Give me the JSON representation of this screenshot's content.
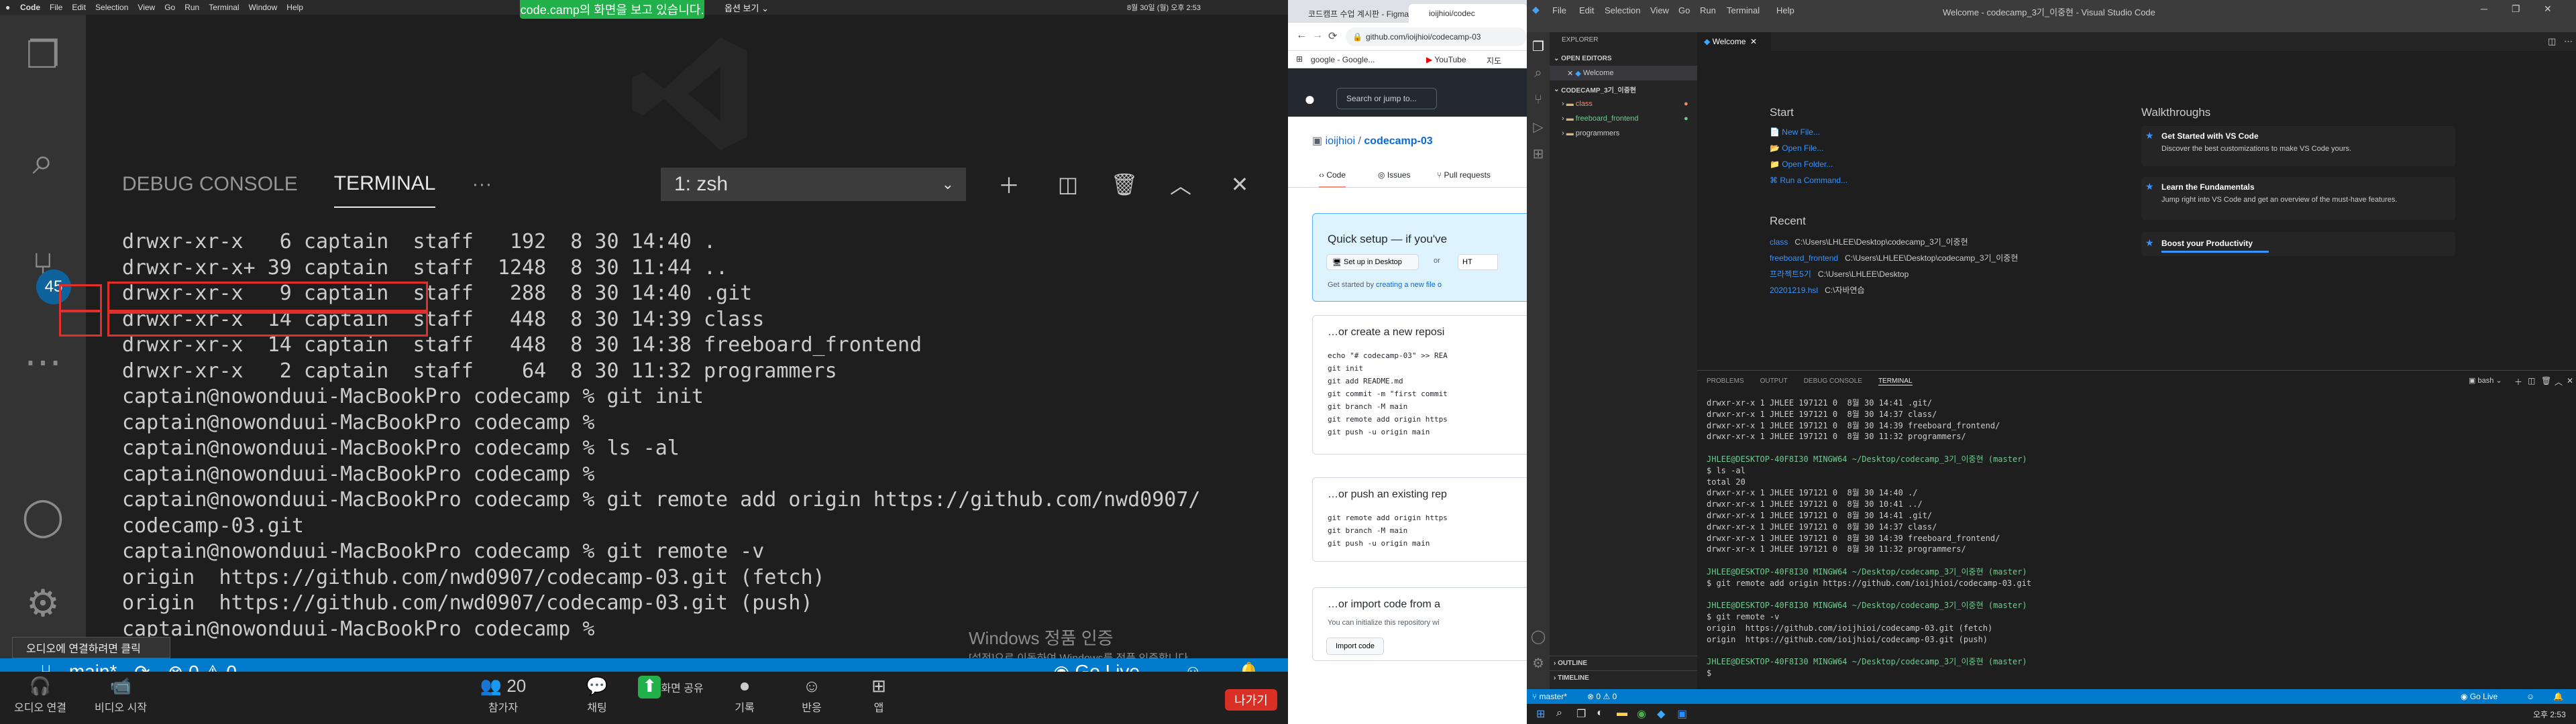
{
  "zoom_share": {
    "mac_menu": [
      "Code",
      "File",
      "Edit",
      "Selection",
      "View",
      "Go",
      "Run",
      "Terminal",
      "Window",
      "Help"
    ],
    "sharing_banner": "code.camp의 화면을 보고 있습니다.",
    "view_options": "옵션 보기 ⌄",
    "top_right_text": "8월 30일 (월) 오후 2:53",
    "activity_badge": "45",
    "panel_tabs": [
      "DEBUG CONSOLE",
      "TERMINAL",
      "···"
    ],
    "terminal_select": "1: zsh",
    "terminal_lines": [
      "drwxr-xr-x   6 captain  staff   192  8 30 14:40 .",
      "drwxr-xr-x+ 39 captain  staff  1248  8 30 11:44 ..",
      "drwxr-xr-x   9 captain  staff   288  8 30 14:40 .git",
      "drwxr-xr-x  14 captain  staff   448  8 30 14:39 class",
      "drwxr-xr-x  14 captain  staff   448  8 30 14:38 freeboard_frontend",
      "drwxr-xr-x   2 captain  staff    64  8 30 11:32 programmers",
      "captain@nowonduui-MacBookPro codecamp % git init",
      "captain@nowonduui-MacBookPro codecamp %",
      "captain@nowonduui-MacBookPro codecamp % ls -al",
      "captain@nowonduui-MacBookPro codecamp %",
      "captain@nowonduui-MacBookPro codecamp % git remote add origin https://github.com/nwd0907/",
      "codecamp-03.git",
      "captain@nowonduui-MacBookPro codecamp % git remote -v",
      "origin  https://github.com/nwd0907/codecamp-03.git (fetch)",
      "origin  https://github.com/nwd0907/codecamp-03.git (push)",
      "captain@nowonduui-MacBookPro codecamp % "
    ],
    "status_branch": "main*",
    "status_problems": "⊗ 0 ⚠ 0",
    "go_live": "Go Live",
    "windows_watermark": "Windows 정품 인증",
    "windows_watermark_sub": "[설정]으로 이동하여 Windows를 정품 인증합니다.",
    "tooltip": "오디오에 연결하려면 클릭",
    "controls": [
      {
        "label": "오디오 연결",
        "icon": "🎧"
      },
      {
        "label": "비디오 시작",
        "icon": "📹"
      },
      {
        "label": "참가자",
        "icon": "👥",
        "count": "20"
      },
      {
        "label": "채팅",
        "icon": "💬"
      },
      {
        "label": "화면 공유",
        "icon": "⬆"
      },
      {
        "label": "기록",
        "icon": "⏺"
      },
      {
        "label": "반응",
        "icon": "☺"
      },
      {
        "label": "앱",
        "icon": "⊞"
      }
    ],
    "leave_button": "나가기"
  },
  "browser": {
    "tabs": [
      "코드캠프 수업 계시판 - Figma",
      "ioijhioi/codec"
    ],
    "url": "github.com/ioijhioi/codecamp-03",
    "bookmarks": [
      "google - Google...",
      "YouTube",
      "지도"
    ],
    "search_placeholder": "Search or jump to...",
    "repo_owner": "ioijhioi",
    "repo_name": "codecamp-03",
    "repo_tabs": [
      "Code",
      "Issues",
      "Pull requests"
    ],
    "quick_setup": "Quick setup — if you've",
    "setup_desktop": "Set up in Desktop",
    "or": "or",
    "https_label": "HT",
    "get_started_prefix": "Get started by",
    "get_started_link": "creating a new file o",
    "section_create": "…or create a new reposi",
    "create_cmds": [
      "echo \"# codecamp-03\" >> REA",
      "git init",
      "git add README.md",
      "git commit -m \"first commit",
      "git branch -M main",
      "git remote add origin https",
      "git push -u origin main"
    ],
    "section_push": "…or push an existing rep",
    "push_cmds": [
      "git remote add origin https",
      "git branch -M main",
      "git push -u origin main"
    ],
    "section_import": "…or import code from a",
    "import_desc": "You can initialize this repository wi",
    "import_button": "Import code"
  },
  "vscode": {
    "menu": [
      "File",
      "Edit",
      "Selection",
      "View",
      "Go",
      "Run",
      "Terminal",
      "Help"
    ],
    "title": "Welcome - codecamp_3기_이중현 - Visual Studio Code",
    "explorer_title": "EXPLORER",
    "open_editors": "OPEN EDITORS",
    "open_editor_item": "Welcome",
    "workspace": "CODECAMP_3기_이중현",
    "folders": [
      {
        "name": "class",
        "color": "#f48771"
      },
      {
        "name": "freeboard_frontend",
        "color": "#73c991"
      },
      {
        "name": "programmers",
        "color": "#cccccc"
      }
    ],
    "outline": "OUTLINE",
    "timeline": "TIMELINE",
    "editor_tab": "Welcome",
    "start_title": "Start",
    "start_links": [
      "New File...",
      "Open File...",
      "Open Folder...",
      "Run a Command..."
    ],
    "recent_title": "Recent",
    "recent": [
      {
        "name": "class",
        "path": "C:\\Users\\LHLEE\\Desktop\\codecamp_3기_이중현"
      },
      {
        "name": "freeboard_frontend",
        "path": "C:\\Users\\LHLEE\\Desktop\\codecamp_3기_이중현"
      },
      {
        "name": "프라젝트5기",
        "path": "C:\\Users\\LHLEE\\Desktop"
      },
      {
        "name": "20201219.hsl",
        "path": "C:\\자바연습"
      }
    ],
    "walkthroughs_title": "Walkthroughs",
    "walkthroughs": [
      {
        "title": "Get Started with VS Code",
        "desc": "Discover the best customizations to make VS Code yours."
      },
      {
        "title": "Learn the Fundamentals",
        "desc": "Jump right into VS Code and get an overview of the must-have features."
      },
      {
        "title": "Boost your Productivity",
        "desc": ""
      }
    ],
    "panel_tabs": [
      "PROBLEMS",
      "OUTPUT",
      "DEBUG CONSOLE",
      "TERMINAL"
    ],
    "terminal_select": "bash",
    "terminal_lines": [
      "drwxr-xr-x 1 JHLEE 197121 0  8월 30 14:41 .git/",
      "drwxr-xr-x 1 JHLEE 197121 0  8월 30 14:37 class/",
      "drwxr-xr-x 1 JHLEE 197121 0  8월 30 14:39 freeboard_frontend/",
      "drwxr-xr-x 1 JHLEE 197121 0  8월 30 11:32 programmers/",
      "",
      "JHLEE@DESKTOP-40F8I30 MINGW64 ~/Desktop/codecamp_3기_이중현 (master)",
      "$ ls -al",
      "total 20",
      "drwxr-xr-x 1 JHLEE 197121 0  8월 30 14:40 ./",
      "drwxr-xr-x 1 JHLEE 197121 0  8월 30 10:41 ../",
      "drwxr-xr-x 1 JHLEE 197121 0  8월 30 14:41 .git/",
      "drwxr-xr-x 1 JHLEE 197121 0  8월 30 14:37 class/",
      "drwxr-xr-x 1 JHLEE 197121 0  8월 30 14:39 freeboard_frontend/",
      "drwxr-xr-x 1 JHLEE 197121 0  8월 30 11:32 programmers/",
      "",
      "JHLEE@DESKTOP-40F8I30 MINGW64 ~/Desktop/codecamp_3기_이중현 (master)",
      "$ git remote add origin https://github.com/ioijhioi/codecamp-03.git",
      "",
      "JHLEE@DESKTOP-40F8I30 MINGW64 ~/Desktop/codecamp_3기_이중현 (master)",
      "$ git remote -v",
      "origin  https://github.com/ioijhioi/codecamp-03.git (fetch)",
      "origin  https://github.com/ioijhioi/codecamp-03.git (push)",
      "",
      "JHLEE@DESKTOP-40F8I30 MINGW64 ~/Desktop/codecamp_3기_이중현 (master)",
      "$ "
    ],
    "status_branch": "master*",
    "status_problems": "⊗ 0 ⚠ 0",
    "status_golive": "Go Live",
    "taskbar_time": "오후 2:53"
  }
}
